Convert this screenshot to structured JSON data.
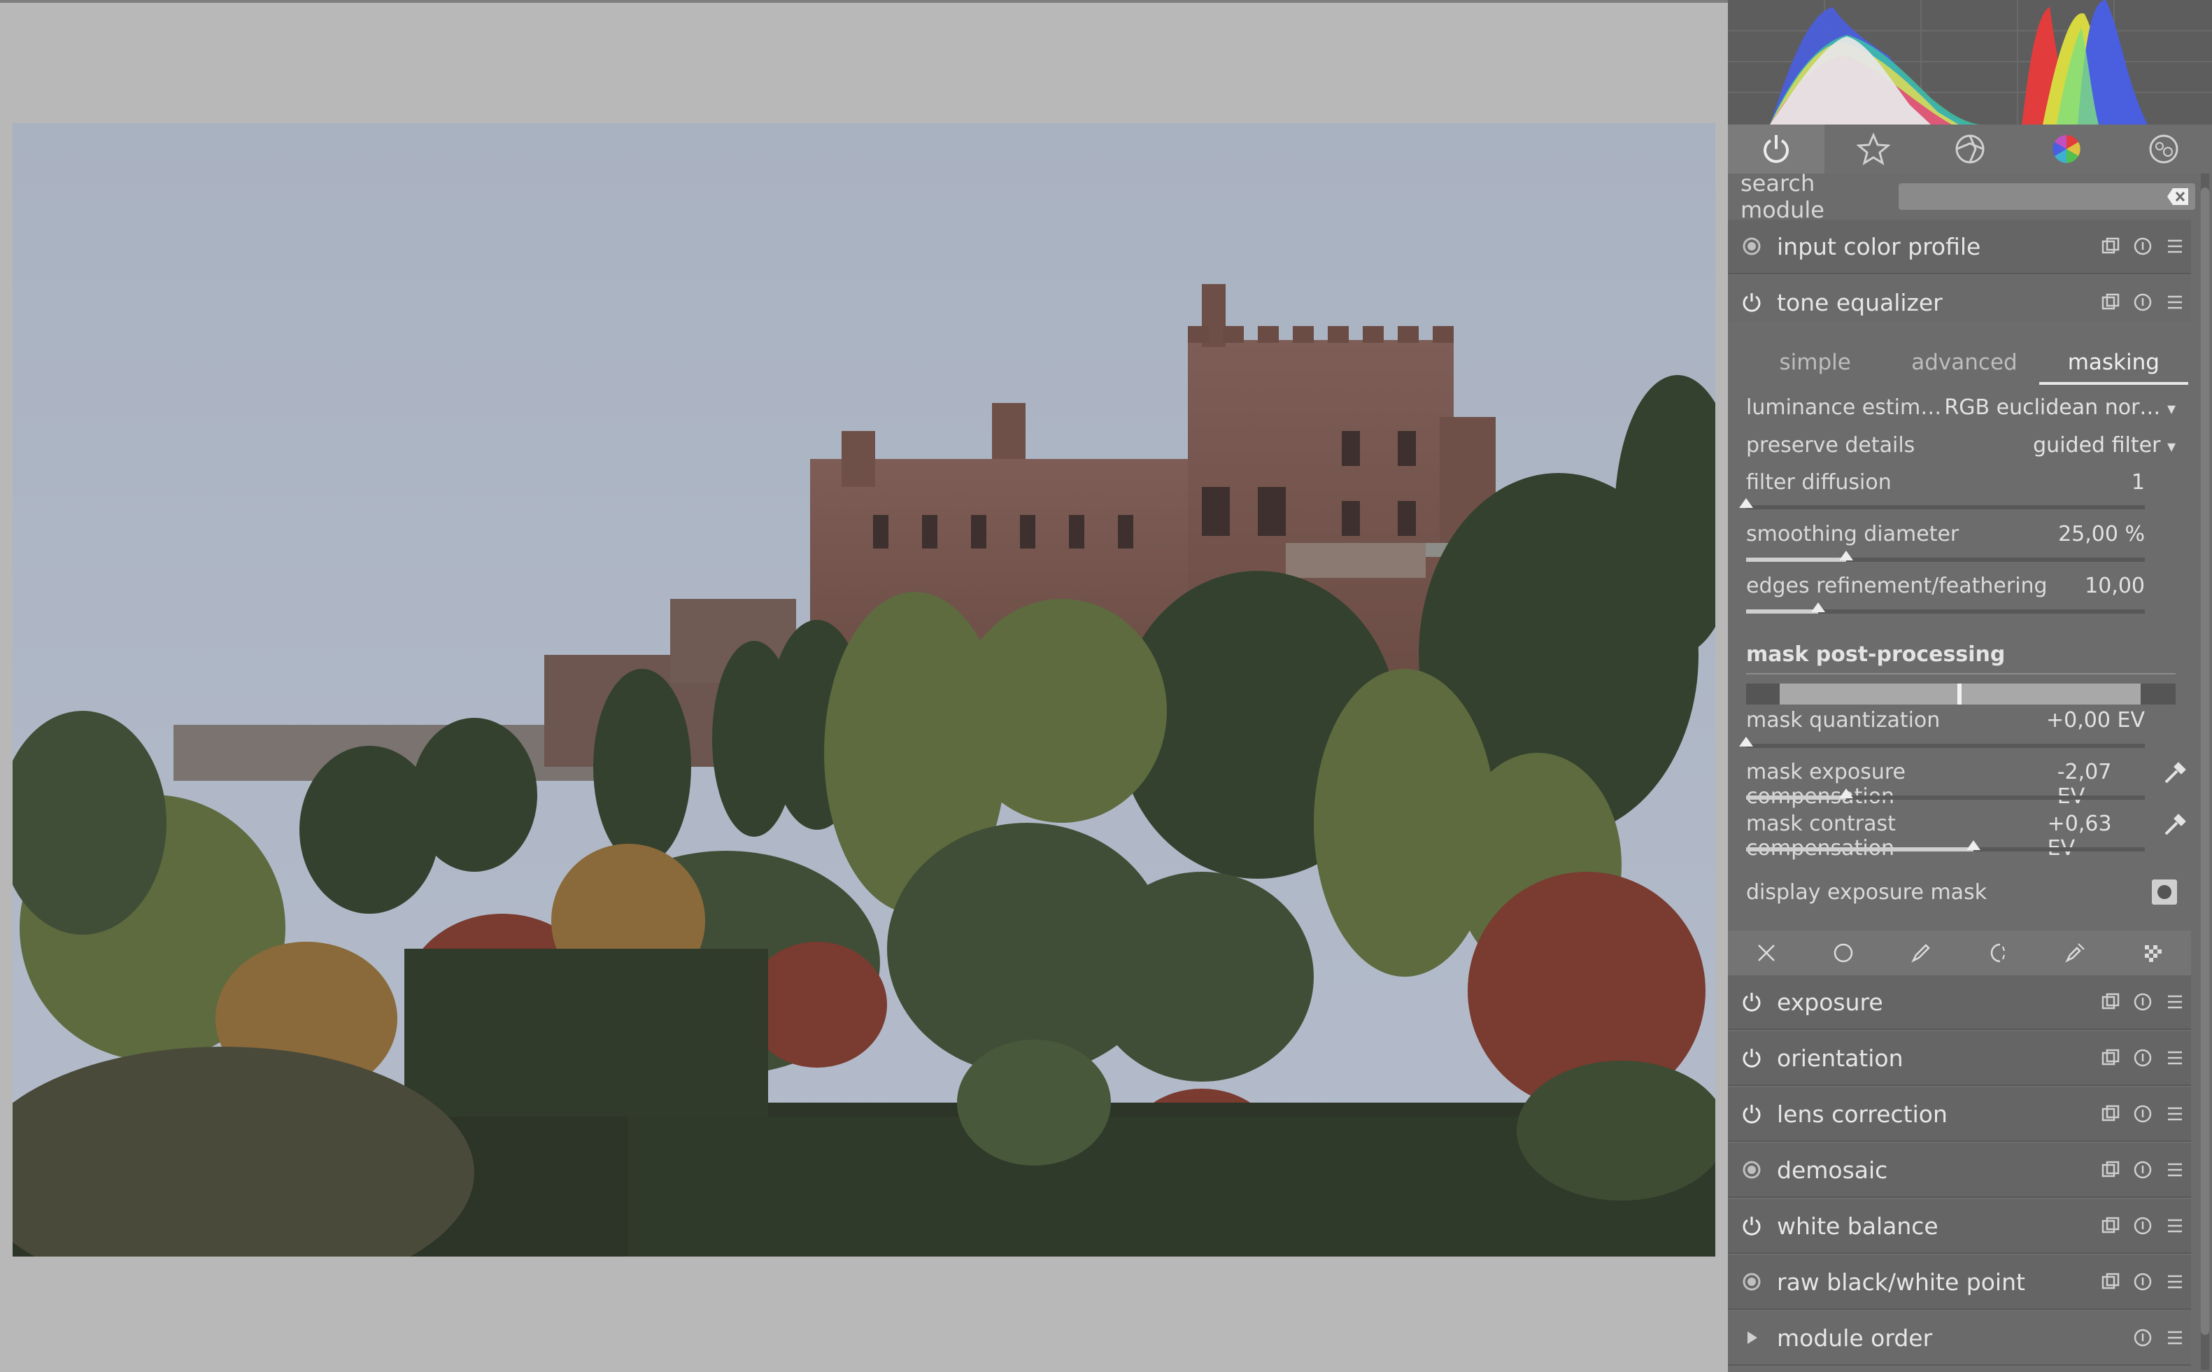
{
  "search": {
    "label": "search module"
  },
  "groups": [
    "active-modules",
    "favorites",
    "technical",
    "color",
    "effects"
  ],
  "tone_equalizer": {
    "title": "tone equalizer",
    "tabs": [
      "simple",
      "advanced",
      "masking"
    ],
    "active_tab": "masking",
    "luminance_estimator": {
      "label": "luminance estim…",
      "value": "RGB euclidean nor…"
    },
    "preserve_details": {
      "label": "preserve details",
      "value": "guided filter"
    },
    "filter_diffusion": {
      "label": "filter diffusion",
      "value": "1",
      "level": 0.0
    },
    "smoothing_diameter": {
      "label": "smoothing diameter",
      "value": "25,00 %",
      "level": 0.25
    },
    "edges_refinement": {
      "label": "edges refinement/feathering",
      "value": "10,00",
      "level": 0.18
    },
    "mask_post_processing": "mask post-processing",
    "mask_quantization": {
      "label": "mask quantization",
      "value": "+0,00 EV",
      "level": 0.0
    },
    "mask_exposure_compensation": {
      "label": "mask exposure compensation",
      "value": "-2,07 EV",
      "level": 0.25
    },
    "mask_contrast_compensation": {
      "label": "mask contrast compensation",
      "value": "+0,63 EV",
      "level": 0.57
    },
    "display_exposure_mask": {
      "label": "display exposure mask"
    }
  },
  "modules_top": [
    {
      "label": "input color profile",
      "state": "always-on"
    }
  ],
  "modules_bottom": [
    {
      "label": "exposure",
      "state": "on"
    },
    {
      "label": "orientation",
      "state": "on"
    },
    {
      "label": "lens correction",
      "state": "on"
    },
    {
      "label": "demosaic",
      "state": "always-on"
    },
    {
      "label": "white balance",
      "state": "on"
    },
    {
      "label": "raw black/white point",
      "state": "always-on"
    }
  ],
  "module_order": {
    "label": "module order"
  },
  "colors": {
    "panel_bg": "#6c6c6c",
    "module_bg": "#656565",
    "center_bg": "#b8b8b8"
  }
}
